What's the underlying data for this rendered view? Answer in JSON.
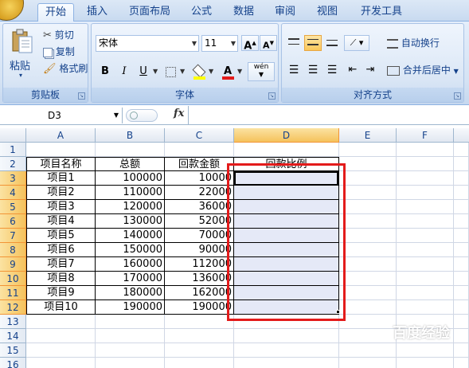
{
  "ribbon_tabs": [
    "开始",
    "插入",
    "页面布局",
    "公式",
    "数据",
    "审阅",
    "视图",
    "开发工具"
  ],
  "clipboard": {
    "paste_label": "粘贴",
    "cut_label": "剪切",
    "copy_label": "复制",
    "format_painter_label": "格式刷",
    "group_label": "剪贴板"
  },
  "font": {
    "name": "宋体",
    "size": "11",
    "grow_label": "A",
    "shrink_label": "A",
    "bold_label": "B",
    "italic_label": "I",
    "underline_label": "U",
    "phonetic_label": "wén",
    "font_color_label": "A",
    "group_label": "字体"
  },
  "alignment": {
    "wrap_text_label": "自动换行",
    "merge_center_label": "合并后居中",
    "group_label": "对齐方式"
  },
  "formula_bar": {
    "name_box": "D3",
    "fx_label": "fx",
    "formula": ""
  },
  "sheet": {
    "columns": [
      "A",
      "B",
      "C",
      "D",
      "E",
      "F"
    ],
    "rows": [
      "1",
      "2",
      "3",
      "4",
      "5",
      "6",
      "7",
      "8",
      "9",
      "10",
      "11",
      "12",
      "13",
      "14",
      "15",
      "16"
    ],
    "headers": [
      "项目名称",
      "总额",
      "回款金额",
      "回款比例"
    ],
    "data": [
      [
        "项目1",
        "100000",
        "10000"
      ],
      [
        "项目2",
        "110000",
        "22000"
      ],
      [
        "项目3",
        "120000",
        "36000"
      ],
      [
        "项目4",
        "130000",
        "52000"
      ],
      [
        "项目5",
        "140000",
        "70000"
      ],
      [
        "项目6",
        "150000",
        "90000"
      ],
      [
        "项目7",
        "160000",
        "112000"
      ],
      [
        "项目8",
        "170000",
        "136000"
      ],
      [
        "项目9",
        "180000",
        "162000"
      ],
      [
        "项目10",
        "190000",
        "190000"
      ]
    ],
    "selected_range": "D3:D12"
  },
  "watermark": "百度经验",
  "colors": {
    "selection_fill": "#e5e9f7",
    "highlight_border": "#e31b1b",
    "header_selected": "#f5c25c",
    "ribbon_text": "#15428b"
  }
}
